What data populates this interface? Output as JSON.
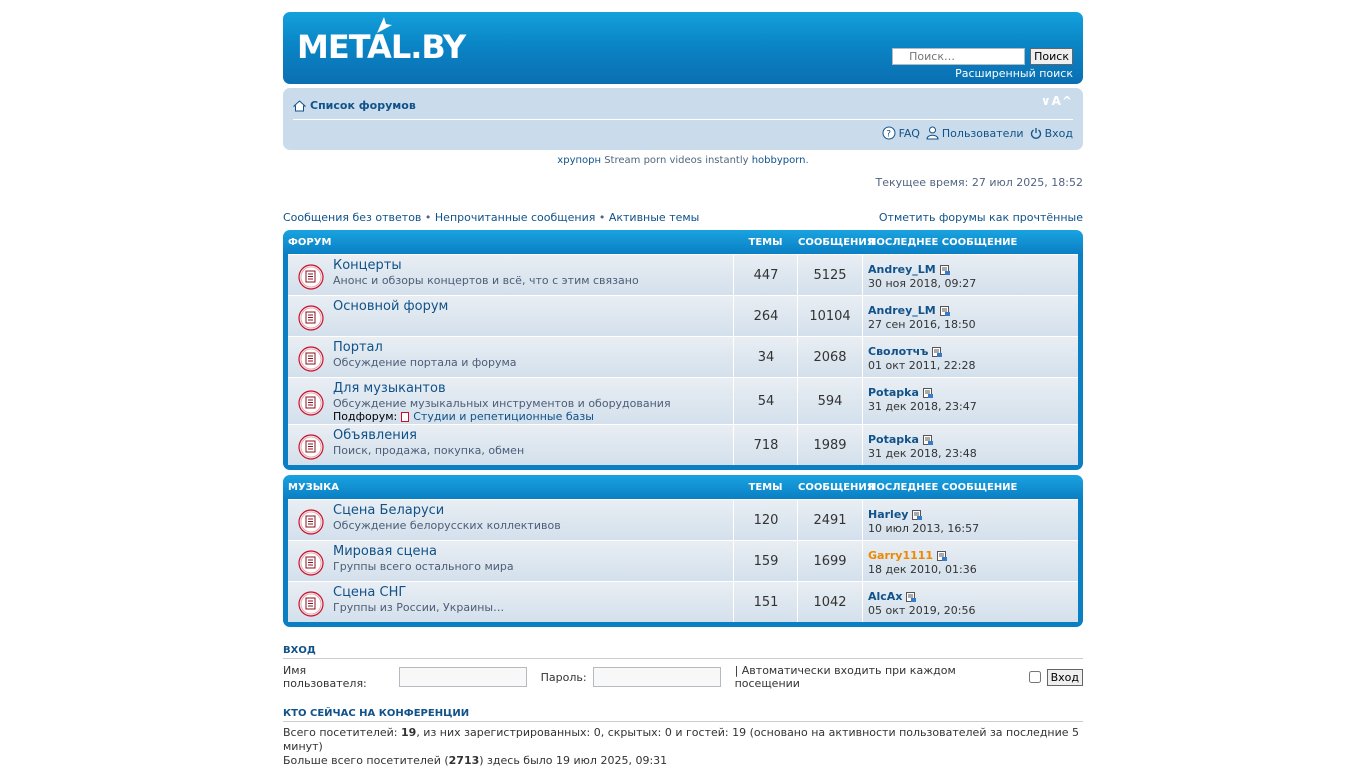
{
  "header": {
    "logo": "METAL.BY",
    "search_placeholder": "Поиск…",
    "search_button": "Поиск",
    "advanced_search": "Расширенный поиск"
  },
  "navbar": {
    "home": "Список форумов",
    "font_size": "∨A^",
    "links": {
      "faq": "FAQ",
      "users": "Пользователи",
      "login": "Вход"
    }
  },
  "ad": {
    "link1": "хрупорн",
    "text": " Stream porn videos instantly ",
    "link2": "hobbyporn",
    "end": "."
  },
  "time": "Текущее время: 27 июл 2025, 18:52",
  "quicklinks": {
    "unanswered": "Сообщения без ответов",
    "sep1": " • ",
    "unread": "Непрочитанные сообщения",
    "sep2": " • ",
    "active": "Активные темы",
    "mark_read": "Отметить форумы как прочтённые"
  },
  "blocks": [
    {
      "title": "ФОРУМ",
      "col_topics": "ТЕМЫ",
      "col_posts": "СООБЩЕНИЯ",
      "col_last": "ПОСЛЕДНЕЕ СООБЩЕНИЕ",
      "rows": [
        {
          "title": "Концерты",
          "desc": "Анонс и обзоры концертов и всё, что с этим связано",
          "topics": "447",
          "posts": "5125",
          "author": "Andrey_LM",
          "date": "30 ноя 2018, 09:27"
        },
        {
          "title": "Основной форум",
          "desc": "",
          "topics": "264",
          "posts": "10104",
          "author": "Andrey_LM",
          "date": "27 сен 2016, 18:50"
        },
        {
          "title": "Портал",
          "desc": "Обсуждение портала и форума",
          "topics": "34",
          "posts": "2068",
          "author": "Сволотчъ",
          "date": "01 окт 2011, 22:28"
        },
        {
          "title": "Для музыкантов",
          "desc": "Обсуждение музыкальных инструментов и оборудования",
          "sub_label": "Подфорум:",
          "sub_link": "Студии и репетиционные базы",
          "topics": "54",
          "posts": "594",
          "author": "Potapka",
          "date": "31 дек 2018, 23:47"
        },
        {
          "title": "Объявления",
          "desc": "Поиск, продажа, покупка, обмен",
          "topics": "718",
          "posts": "1989",
          "author": "Potapka",
          "date": "31 дек 2018, 23:48"
        }
      ]
    },
    {
      "title": "МУЗЫКА",
      "col_topics": "ТЕМЫ",
      "col_posts": "СООБЩЕНИЯ",
      "col_last": "ПОСЛЕДНЕЕ СООБЩЕНИЕ",
      "rows": [
        {
          "title": "Сцена Беларуси",
          "desc": "Обсуждение белорусских коллективов",
          "topics": "120",
          "posts": "2491",
          "author": "Harley",
          "date": "10 июл 2013, 16:57"
        },
        {
          "title": "Мировая сцена",
          "desc": "Группы всего остального мира",
          "topics": "159",
          "posts": "1699",
          "author": "Garry1111",
          "author_color": "#ee8800",
          "date": "18 дек 2010, 01:36"
        },
        {
          "title": "Сцена СНГ",
          "desc": "Группы из России, Украины…",
          "topics": "151",
          "posts": "1042",
          "author": "AlcAx",
          "date": "05 окт 2019, 20:56"
        }
      ]
    }
  ],
  "login": {
    "title": "ВХОД",
    "username_label": "Имя пользователя:",
    "password_label": "Пароль:",
    "autologin_label": "| Автоматически входить при каждом посещении",
    "button": "Вход"
  },
  "who": {
    "title": "КТО СЕЙЧАС НА КОНФЕРЕНЦИИ",
    "line1_a": "Всего посетителей: ",
    "line1_total": "19",
    "line1_b": ", из них зарегистрированных: 0, скрытых: 0 и гостей: 19 (основано на активности пользователей за последние 5 минут)",
    "line2_a": "Больше всего посетителей (",
    "line2_max": "2713",
    "line2_b": ") здесь было 19 июл 2025, 09:31"
  },
  "colors": {
    "brand_blue": "#0a7fc4",
    "link": "#105289",
    "nav_bg": "#cadceb",
    "highlight_user": "#ee8800"
  }
}
